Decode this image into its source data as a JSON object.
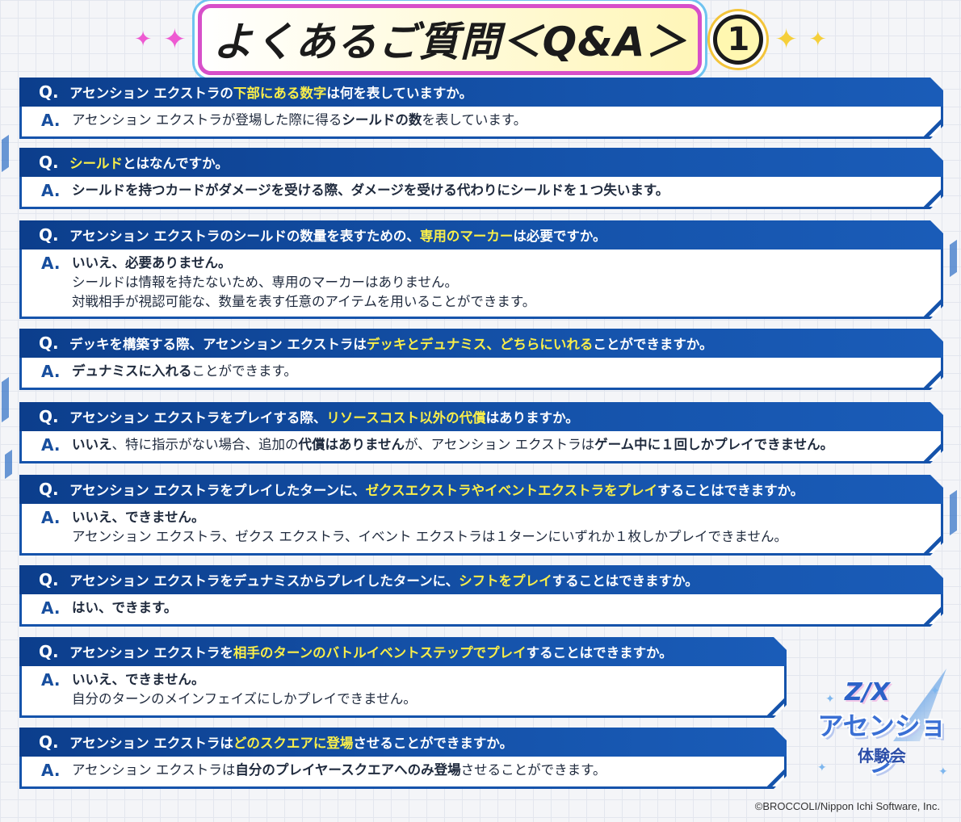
{
  "title": {
    "main": "よくあるご質問＜Q&A＞",
    "number": "1"
  },
  "labels": {
    "q": "Q.",
    "a": "A."
  },
  "items": [
    {
      "q": [
        {
          "t": "アセンション エクストラの"
        },
        {
          "t": "下部にある数字",
          "h": true
        },
        {
          "t": "は何を表していますか。"
        }
      ],
      "a": [
        [
          {
            "t": "アセンション エクストラが登場した際に得る"
          },
          {
            "t": "シールドの数",
            "b": true
          },
          {
            "t": "を表しています。"
          }
        ]
      ]
    },
    {
      "q": [
        {
          "t": "シールド",
          "h": true
        },
        {
          "t": "とはなんですか。"
        }
      ],
      "a": [
        [
          {
            "t": "シールドを持つカードがダメージを受ける際、ダメージを受ける代わりにシールドを１つ失います。",
            "b": true
          }
        ]
      ]
    },
    {
      "q": [
        {
          "t": "アセンション エクストラのシールドの数量を表すための、"
        },
        {
          "t": "専用のマーカー",
          "h": true
        },
        {
          "t": "は必要ですか。"
        }
      ],
      "a": [
        [
          {
            "t": "いいえ、必要ありません。",
            "b": true
          }
        ],
        [
          {
            "t": "シールドは情報を持たないため、専用のマーカーはありません。"
          }
        ],
        [
          {
            "t": "対戦相手が視認可能な、数量を表す任意のアイテムを用いることができます。"
          }
        ]
      ]
    },
    {
      "q": [
        {
          "t": "デッキを構築する際、アセンション エクストラは"
        },
        {
          "t": "デッキとデュナミス、どちらにいれる",
          "h": true
        },
        {
          "t": "ことができますか。"
        }
      ],
      "a": [
        [
          {
            "t": "デュナミスに入れる",
            "b": true
          },
          {
            "t": "ことができます。"
          }
        ]
      ]
    },
    {
      "q": [
        {
          "t": "アセンション エクストラをプレイする際、"
        },
        {
          "t": "リソースコスト以外の代償",
          "h": true
        },
        {
          "t": "はありますか。"
        }
      ],
      "a": [
        [
          {
            "t": "いいえ",
            "b": true
          },
          {
            "t": "、特に指示がない場合、追加の"
          },
          {
            "t": "代償はありません",
            "b": true
          },
          {
            "t": "が、アセンション エクストラは"
          },
          {
            "t": "ゲーム中に１回しかプレイできません。",
            "b": true
          }
        ]
      ]
    },
    {
      "q": [
        {
          "t": "アセンション エクストラをプレイしたターンに、"
        },
        {
          "t": "ゼクスエクストラやイベントエクストラをプレイ",
          "h": true
        },
        {
          "t": "することはできますか。"
        }
      ],
      "a": [
        [
          {
            "t": "いいえ、できません。",
            "b": true
          }
        ],
        [
          {
            "t": "アセンション エクストラ、ゼクス エクストラ、イベント エクストラは１ターンにいずれか１枚しかプレイできません。"
          }
        ]
      ]
    },
    {
      "q": [
        {
          "t": "アセンション エクストラをデュナミスからプレイしたターンに、"
        },
        {
          "t": "シフトをプレイ",
          "h": true
        },
        {
          "t": "することはできますか。"
        }
      ],
      "a": [
        [
          {
            "t": "はい、できます。",
            "b": true
          }
        ]
      ]
    },
    {
      "q": [
        {
          "t": "アセンション エクストラを"
        },
        {
          "t": "相手のターンのバトルイベントステップでプレイ",
          "h": true
        },
        {
          "t": "することはできますか。"
        }
      ],
      "a": [
        [
          {
            "t": "いいえ、できません。",
            "b": true
          }
        ],
        [
          {
            "t": "自分のターンのメインフェイズにしかプレイできません。"
          }
        ]
      ]
    },
    {
      "q": [
        {
          "t": "アセンション エクストラは"
        },
        {
          "t": "どのスクエアに登場",
          "h": true
        },
        {
          "t": "させることができますか。"
        }
      ],
      "a": [
        [
          {
            "t": "アセンション エクストラは"
          },
          {
            "t": "自分のプレイヤースクエアへのみ登場",
            "b": true
          },
          {
            "t": "させることができます。"
          }
        ]
      ]
    }
  ],
  "logo": {
    "brand": "Z/X",
    "main": "アセンション",
    "sub": "体験会"
  },
  "copyright": "©BROCCOLI/Nippon Ichi Software, Inc."
}
